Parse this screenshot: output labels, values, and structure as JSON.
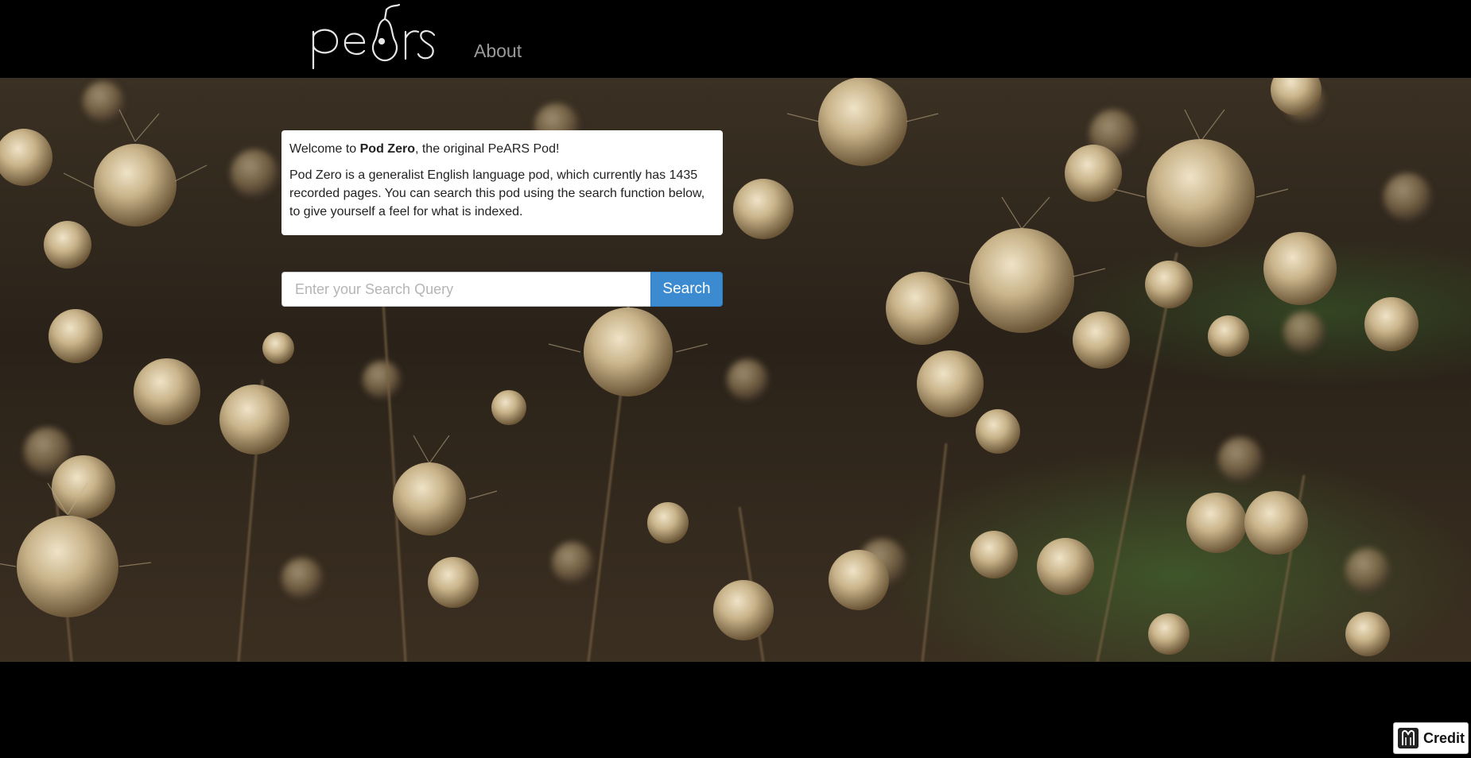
{
  "navbar": {
    "logo_text": "pears",
    "about_label": "About"
  },
  "welcome": {
    "intro_prefix": "Welcome to ",
    "pod_name": "Pod Zero",
    "intro_suffix": ", the original PeARS Pod!",
    "description": "Pod Zero is a generalist English language pod, which currently has 1435 recorded pages. You can search this pod using the search function below, to give yourself a feel for what is indexed."
  },
  "search": {
    "placeholder": "Enter your Search Query",
    "value": "",
    "button_label": "Search",
    "button_color": "#3c8bd0"
  },
  "credit": {
    "label": "Credit",
    "icon": "camera-icon"
  },
  "hero": {
    "image": "dried-seed-pods-photo"
  }
}
